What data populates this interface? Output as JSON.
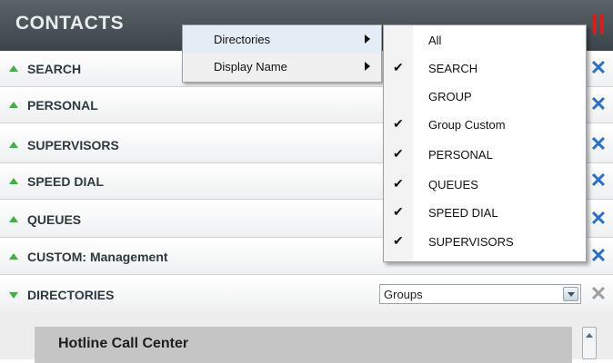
{
  "header": {
    "title": "CONTACTS"
  },
  "rows": [
    {
      "label": "SEARCH"
    },
    {
      "label": "PERSONAL"
    },
    {
      "label": "SUPERVISORS"
    },
    {
      "label": "SPEED DIAL"
    },
    {
      "label": "QUEUES"
    },
    {
      "label": "CUSTOM: Management"
    },
    {
      "label": "DIRECTORIES"
    }
  ],
  "directories": {
    "select_value": "Groups",
    "card_title": "Hotline Call Center"
  },
  "menu": {
    "items": [
      {
        "label": "Directories"
      },
      {
        "label": "Display Name"
      }
    ]
  },
  "submenu": {
    "items": [
      {
        "label": "All",
        "checked": false
      },
      {
        "label": "SEARCH",
        "checked": true
      },
      {
        "label": "GROUP",
        "checked": false
      },
      {
        "label": "Group Custom",
        "checked": true
      },
      {
        "label": "PERSONAL",
        "checked": true
      },
      {
        "label": "QUEUES",
        "checked": true
      },
      {
        "label": "SPEED DIAL",
        "checked": true
      },
      {
        "label": "SUPERVISORS",
        "checked": true
      }
    ]
  },
  "icons": {
    "close": "close-icon",
    "expand": "triangle-up-icon",
    "collapse": "triangle-down-icon",
    "check": "checkmark-icon"
  },
  "colors": {
    "header_bg": "#48535a",
    "accent_green": "#41b041",
    "close_blue": "#2a6fc8"
  }
}
